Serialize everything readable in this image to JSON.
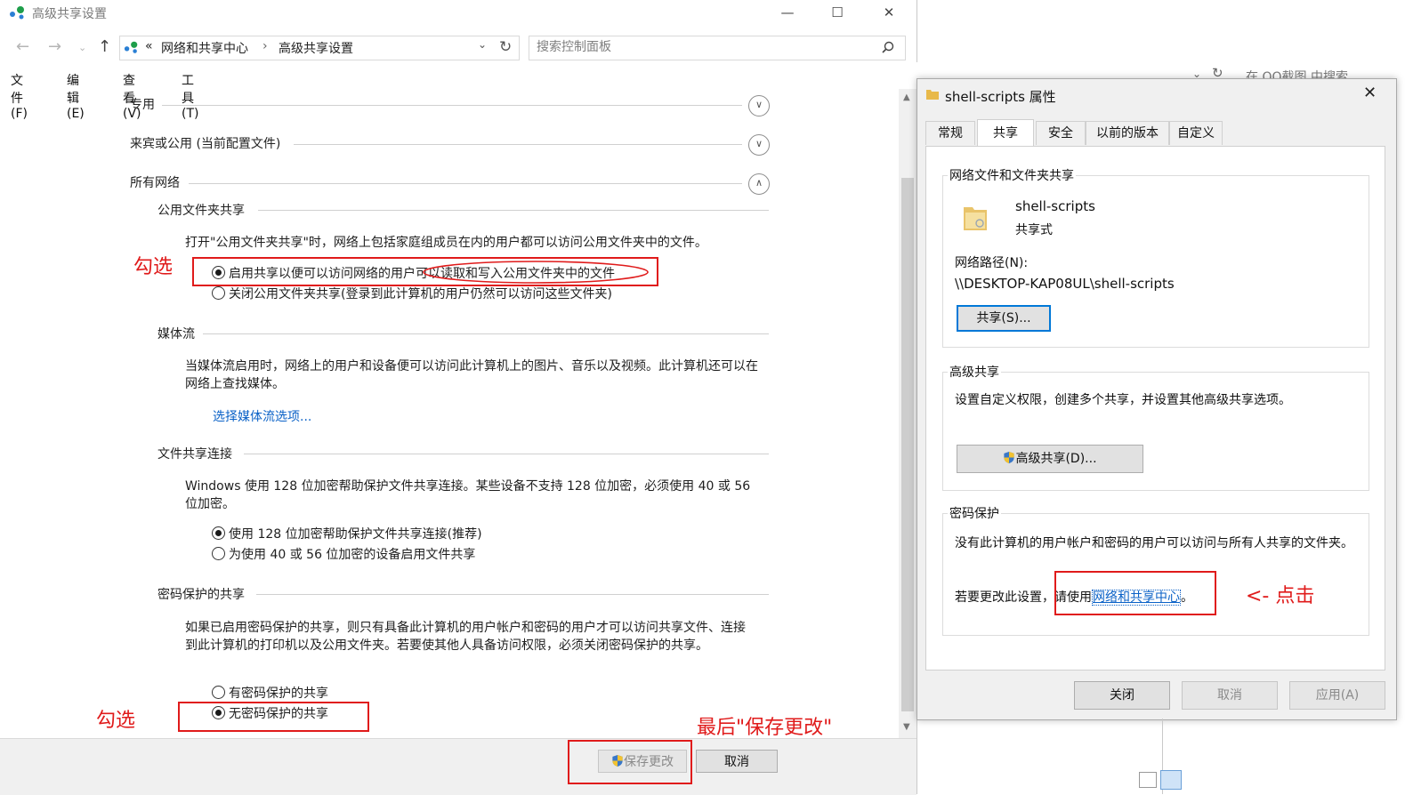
{
  "left_window": {
    "title": "高级共享设置",
    "breadcrumb": [
      "«",
      "网络和共享中心",
      "›",
      "高级共享设置"
    ],
    "search_placeholder": "搜索控制面板",
    "menu": [
      "文件(F)",
      "编辑(E)",
      "查看(V)",
      "工具(T)"
    ],
    "sections": {
      "private": "专用",
      "guest_public": "来宾或公用 (当前配置文件)",
      "all_networks": "所有网络"
    },
    "public_folder": {
      "heading": "公用文件夹共享",
      "desc": "打开\"公用文件夹共享\"时，网络上包括家庭组成员在内的用户都可以访问公用文件夹中的文件。",
      "opt_on": "启用共享以便可以访问网络的用户可以读取和写入公用文件夹中的文件",
      "opt_off": "关闭公用文件夹共享(登录到此计算机的用户仍然可以访问这些文件夹)"
    },
    "media": {
      "heading": "媒体流",
      "desc": "当媒体流启用时，网络上的用户和设备便可以访问此计算机上的图片、音乐以及视频。此计算机还可以在网络上查找媒体。",
      "link": "选择媒体流选项..."
    },
    "file_sharing": {
      "heading": "文件共享连接",
      "desc": "Windows 使用 128 位加密帮助保护文件共享连接。某些设备不支持 128 位加密，必须使用 40 或 56 位加密。",
      "opt_128": "使用 128 位加密帮助保护文件共享连接(推荐)",
      "opt_40_56": "为使用 40 或 56 位加密的设备启用文件共享"
    },
    "password": {
      "heading": "密码保护的共享",
      "desc": "如果已启用密码保护的共享，则只有具备此计算机的用户帐户和密码的用户才可以访问共享文件、连接到此计算机的打印机以及公用文件夹。若要使其他人具备访问权限，必须关闭密码保护的共享。",
      "opt_on": "有密码保护的共享",
      "opt_off": "无密码保护的共享"
    },
    "buttons": {
      "save": "保存更改",
      "cancel": "取消"
    }
  },
  "annotations": {
    "check1": "勾选",
    "check2": "勾选",
    "save_last": "最后\"保存更改\"",
    "click_here": "<- 点击"
  },
  "right_window": {
    "title": "shell-scripts 属性",
    "tabs": [
      "常规",
      "共享",
      "安全",
      "以前的版本",
      "自定义"
    ],
    "net_share": {
      "group_title": "网络文件和文件夹共享",
      "folder_name": "shell-scripts",
      "share_type": "共享式",
      "path_label": "网络路径(N):",
      "path": "\\\\DESKTOP-KAP08UL\\shell-scripts",
      "share_btn": "共享(S)..."
    },
    "advanced": {
      "group_title": "高级共享",
      "desc": "设置自定义权限，创建多个共享，并设置其他高级共享选项。",
      "btn": "高级共享(D)..."
    },
    "pwd": {
      "group_title": "密码保护",
      "desc": "没有此计算机的用户帐户和密码的用户可以访问与所有人共享的文件夹。",
      "change_prefix": "若要更改此设置，请使用",
      "change_link": "网络和共享中心",
      "change_suffix": "。"
    },
    "buttons": {
      "close": "关闭",
      "cancel": "取消",
      "apply": "应用(A)"
    }
  },
  "background_window": {
    "search_hint": "在 QQ截图 中搜索"
  },
  "colors": {
    "annotation_red": "#e01b1b",
    "link_blue": "#0b62c7",
    "accent_button_border": "#0078d7"
  }
}
